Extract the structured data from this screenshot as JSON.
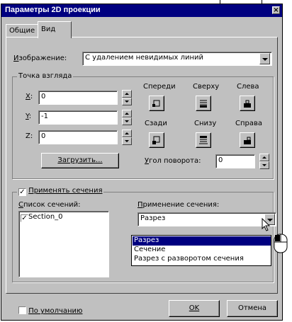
{
  "window": {
    "title": "Параметры 2D проекции",
    "close_glyph": "×"
  },
  "tabs": [
    {
      "label": "Общие"
    },
    {
      "label": "Вид"
    }
  ],
  "image": {
    "label": "Изображение:",
    "value": "С удалением невидимых линий"
  },
  "viewpoint": {
    "group_title": "Точка взгляда",
    "x_label": "X:",
    "x_value": "0",
    "y_label": "Y:",
    "y_value": "-1",
    "z_label": "Z:",
    "z_value": "0",
    "load_button": "Загрузить...",
    "views": [
      {
        "label": "Спереди",
        "icon": "front-view-icon"
      },
      {
        "label": "Сверху",
        "icon": "top-view-icon"
      },
      {
        "label": "Слева",
        "icon": "left-view-icon"
      },
      {
        "label": "Сзади",
        "icon": "back-view-icon"
      },
      {
        "label": "Снизу",
        "icon": "bottom-view-icon"
      },
      {
        "label": "Справа",
        "icon": "right-view-icon"
      }
    ],
    "rotation_label": "Угол поворота:",
    "rotation_value": "0"
  },
  "sections": {
    "apply_label": "Применять сечения",
    "apply_checked": true,
    "list_label": "Список сечений:",
    "list_items": [
      {
        "label": "Section_0",
        "checked": true
      }
    ],
    "usage_label": "Применение сечения:",
    "usage_value": "Разрез",
    "usage_options": [
      "Разрез",
      "Сечение",
      "Разрез с разворотом сечения"
    ],
    "usage_selected_index": 0
  },
  "footer": {
    "default_label": "По умолчанию",
    "default_checked": false,
    "ok_label": "OK",
    "cancel_label": "Отмена"
  },
  "colors": {
    "titlebar": "#000080",
    "face": "#c0c0c0",
    "selection": "#000080"
  }
}
